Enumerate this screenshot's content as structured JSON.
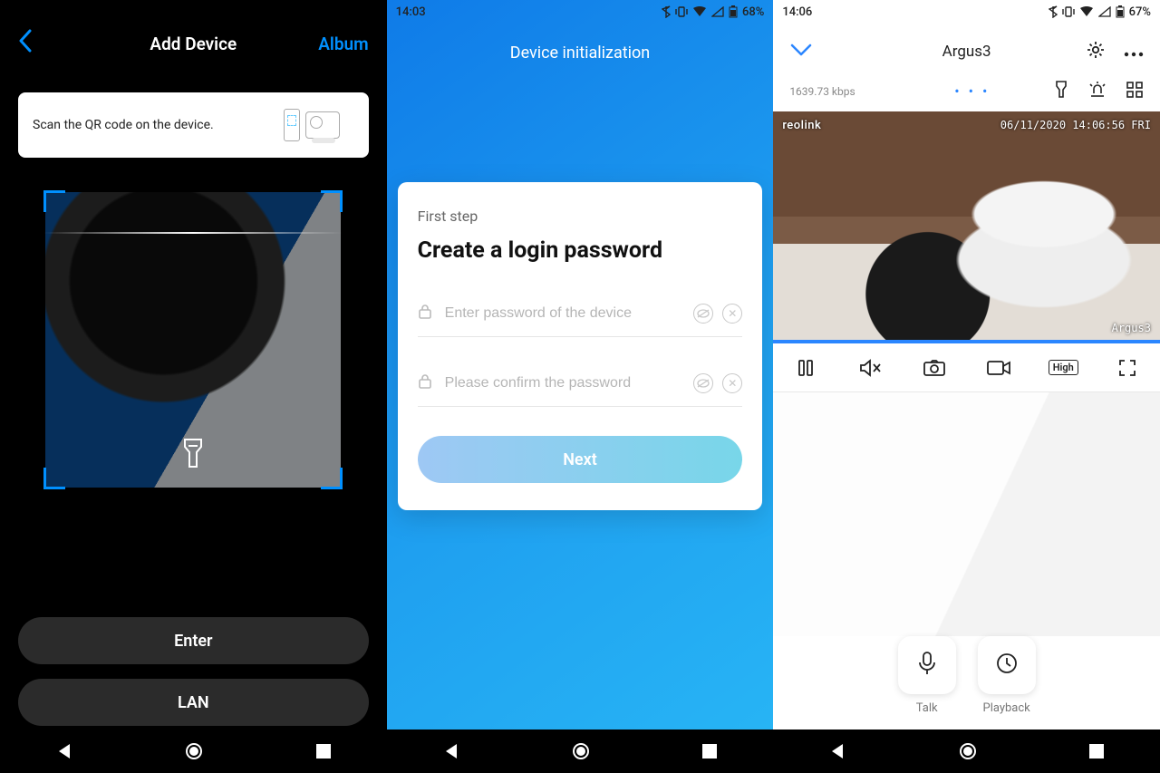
{
  "pane1": {
    "title": "Add Device",
    "album": "Album",
    "tip": "Scan the QR code on the device.",
    "enter": "Enter",
    "lan": "LAN"
  },
  "pane2": {
    "statusbar": {
      "time": "14:03",
      "battery": "68%"
    },
    "header": "Device initialization",
    "step_label": "First step",
    "heading": "Create a login password",
    "password_placeholder": "Enter password of the device",
    "confirm_placeholder": "Please confirm the password",
    "next": "Next"
  },
  "pane3": {
    "statusbar": {
      "time": "14:06",
      "battery": "67%"
    },
    "title": "Argus3",
    "bitrate": "1639.73 kbps",
    "overlay": {
      "brand": "reolink",
      "timestamp": "06/11/2020 14:06:56 FRI",
      "camera_name": "Argus3"
    },
    "quality": "High",
    "actions": {
      "talk": "Talk",
      "playback": "Playback"
    }
  }
}
